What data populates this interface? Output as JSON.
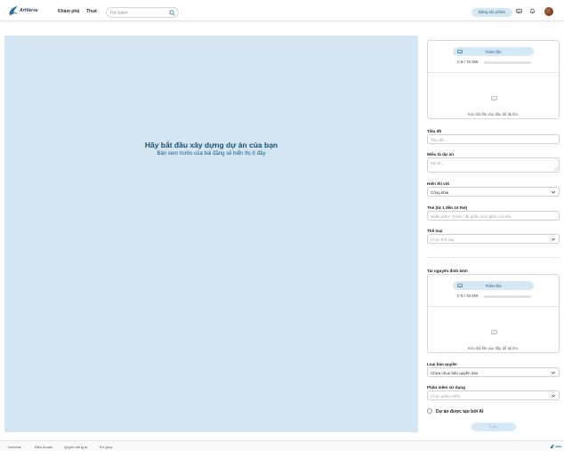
{
  "header": {
    "logo_text": "ArtVerse",
    "nav": [
      "Khám phá",
      "Thuê"
    ],
    "search_placeholder": "Tìm kiếm",
    "partner_button": "Đăng tác phẩm"
  },
  "preview": {
    "title": "Hãy bắt đầu xây dựng dự án của bạn",
    "subtitle": "Bản xem trước của bài đăng sẽ hiển thị ở đây"
  },
  "upload": {
    "add_file": "Thêm file",
    "size": "0 B / 50 MB",
    "progress": 0,
    "drop_text": "Kéo thả file vào đây để tải lên."
  },
  "form": {
    "title_label": "Tiêu đề",
    "title_placeholder": "Tiêu đề ...",
    "desc_label": "Miêu tả dự án",
    "desc_placeholder": "Mô tả ...",
    "visibility_label": "Hiển thị với",
    "visibility_value": "Công khai",
    "tags_label": "Thẻ (từ 1 đến 10 thẻ)",
    "tags_placeholder": "Nhấn phím \"Enter\" để phân tách giữa các thẻ",
    "category_label": "Thể loại",
    "category_placeholder": "Chọn thể loại",
    "attachments_label": "Tài nguyên đính kèm",
    "license_label": "Loại bản quyền",
    "license_value": "Chưa chọn bản quyền nào",
    "software_label": "Phần mềm sử dụng",
    "software_placeholder": "Chọn phần mềm",
    "ai_label": "Dự án được tạo bởi AI",
    "save_button": "Lưu"
  },
  "footer": {
    "links": [
      "Artverse",
      "Điều khoản",
      "Quyền riêng tư",
      "Trợ giúp"
    ]
  },
  "colors": {
    "accent": "#2c7bbf",
    "preview_bg": "#d4e6f3",
    "button_bg": "#d6e8f4"
  }
}
